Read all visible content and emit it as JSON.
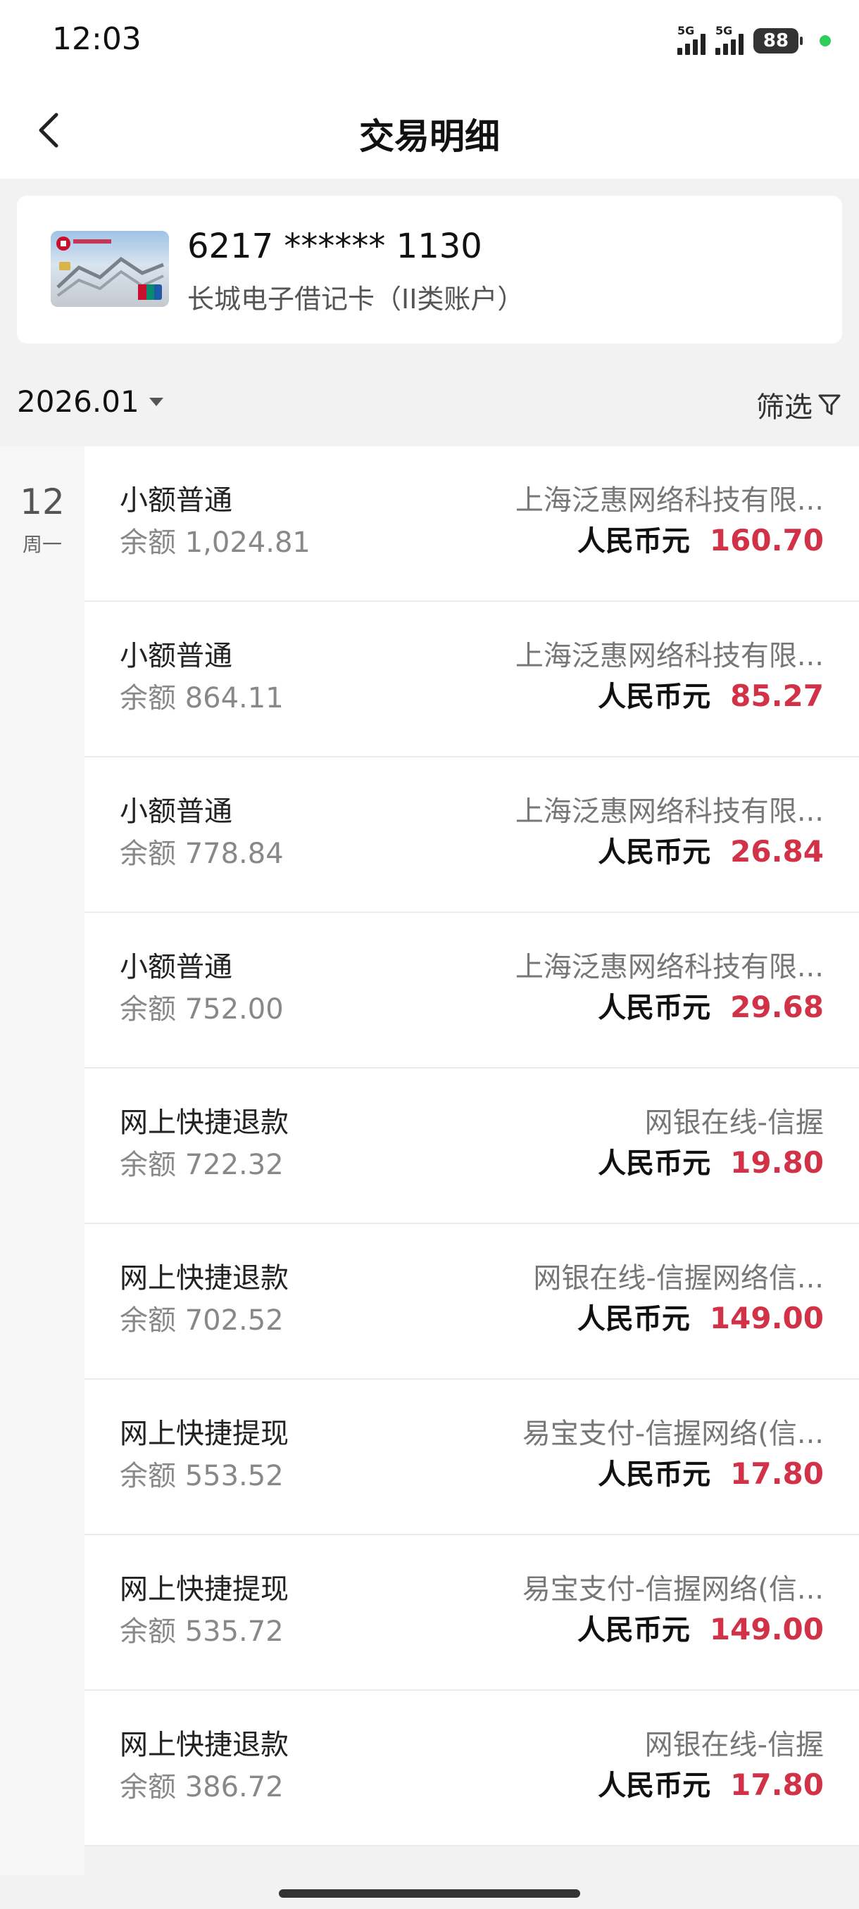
{
  "status_bar": {
    "time": "12:03",
    "network1": "5G",
    "network2": "5G",
    "battery": "88"
  },
  "header": {
    "title": "交易明细"
  },
  "card": {
    "number": "6217 ****** 1130",
    "name": "长城电子借记卡（II类账户）"
  },
  "filter": {
    "month": "2026.01",
    "filter_label": "筛选"
  },
  "date_group": {
    "day": "12",
    "weekday": "周一"
  },
  "transactions": [
    {
      "title": "小额普通",
      "balance": "余额 1,024.81",
      "merchant": "上海泛惠网络科技有限...",
      "currency": "人民币元",
      "amount": "160.70"
    },
    {
      "title": "小额普通",
      "balance": "余额 864.11",
      "merchant": "上海泛惠网络科技有限...",
      "currency": "人民币元",
      "amount": "85.27"
    },
    {
      "title": "小额普通",
      "balance": "余额 778.84",
      "merchant": "上海泛惠网络科技有限...",
      "currency": "人民币元",
      "amount": "26.84"
    },
    {
      "title": "小额普通",
      "balance": "余额 752.00",
      "merchant": "上海泛惠网络科技有限...",
      "currency": "人民币元",
      "amount": "29.68"
    },
    {
      "title": "网上快捷退款",
      "balance": "余额 722.32",
      "merchant": "网银在线-信握",
      "currency": "人民币元",
      "amount": "19.80"
    },
    {
      "title": "网上快捷退款",
      "balance": "余额 702.52",
      "merchant": "网银在线-信握网络信...",
      "currency": "人民币元",
      "amount": "149.00"
    },
    {
      "title": "网上快捷提现",
      "balance": "余额 553.52",
      "merchant": "易宝支付-信握网络(信...",
      "currency": "人民币元",
      "amount": "17.80"
    },
    {
      "title": "网上快捷提现",
      "balance": "余额 535.72",
      "merchant": "易宝支付-信握网络(信...",
      "currency": "人民币元",
      "amount": "149.00"
    },
    {
      "title": "网上快捷退款",
      "balance": "余额 386.72",
      "merchant": "网银在线-信握",
      "currency": "人民币元",
      "amount": "17.80"
    }
  ],
  "colors": {
    "amount": "#d23247",
    "accent_dot": "#2ecc5b"
  },
  "icons": {
    "back": "chevron-left-icon",
    "filter": "funnel-icon",
    "dropdown": "caret-down-icon"
  }
}
